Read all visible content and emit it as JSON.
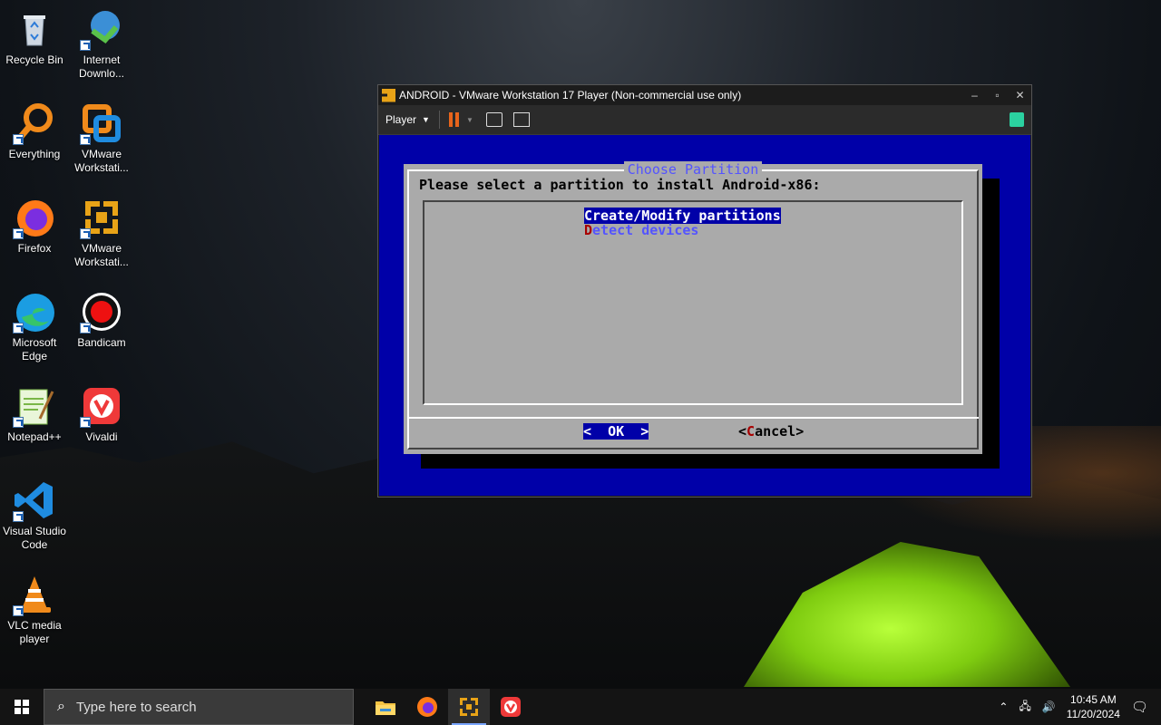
{
  "desktop": {
    "icons": [
      {
        "label": "Recycle Bin",
        "icon": "recycle-bin-icon"
      },
      {
        "label": "Internet Downlo...",
        "icon": "internet-download-manager-icon"
      },
      {
        "label": "Everything",
        "icon": "everything-search-icon"
      },
      {
        "label": "VMware Workstati...",
        "icon": "vmware-workstation-icon"
      },
      {
        "label": "Firefox",
        "icon": "firefox-icon"
      },
      {
        "label": "VMware Workstati...",
        "icon": "vmware-player-icon"
      },
      {
        "label": "Microsoft Edge",
        "icon": "edge-icon"
      },
      {
        "label": "Bandicam",
        "icon": "bandicam-icon"
      },
      {
        "label": "Notepad++",
        "icon": "notepad-plus-plus-icon"
      },
      {
        "label": "Vivaldi",
        "icon": "vivaldi-icon"
      },
      {
        "label": "Visual Studio Code",
        "icon": "vscode-icon"
      },
      {
        "label": "VLC media player",
        "icon": "vlc-icon"
      }
    ]
  },
  "vm_window": {
    "title": "ANDROID - VMware Workstation 17 Player (Non-commercial use only)",
    "toolbar": {
      "player_label": "Player"
    },
    "dialog": {
      "title": "Choose Partition",
      "prompt": "Please select a partition to install Android-x86:",
      "options": [
        {
          "hotkey": "C",
          "rest": "reate/Modify partitions",
          "selected": true
        },
        {
          "hotkey": "D",
          "rest": "etect devices",
          "selected": false
        }
      ],
      "ok_label": "<  OK  >",
      "cancel_prefix": "<",
      "cancel_hotkey": "C",
      "cancel_rest": "ancel>"
    }
  },
  "taskbar": {
    "search_placeholder": "Type here to search",
    "apps": [
      "file-explorer-icon",
      "firefox-icon",
      "vmware-player-icon",
      "vivaldi-icon"
    ],
    "time": "10:45 AM",
    "date": "11/20/2024"
  },
  "colors": {
    "vm_screen_bg": "#0000a8",
    "dialog_bg": "#aaaaaa",
    "hotkey_red": "#a80000",
    "accent_blue": "#5454ff"
  }
}
